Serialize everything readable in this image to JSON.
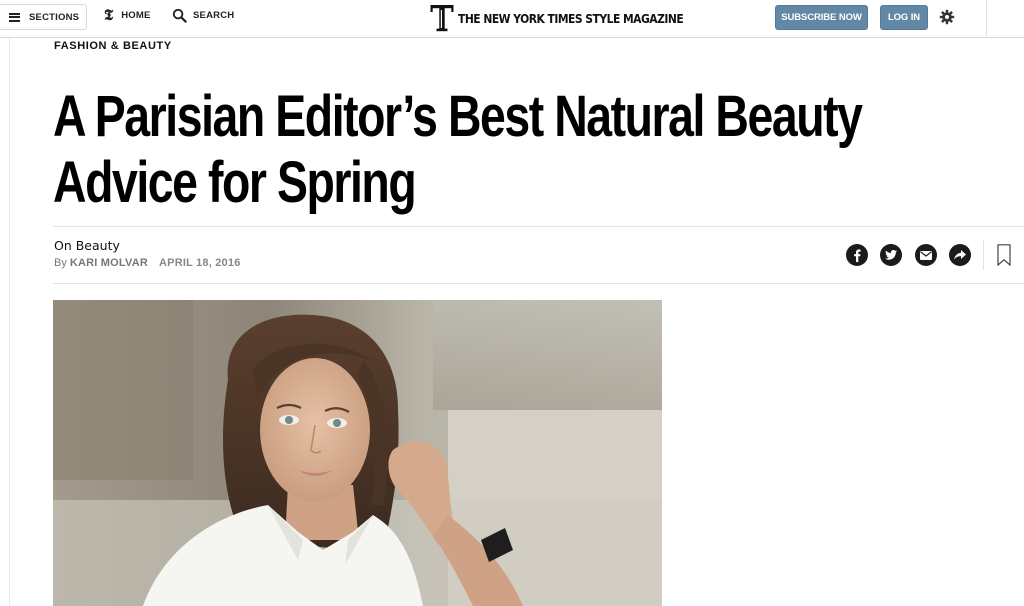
{
  "nav": {
    "sections_label": "SECTIONS",
    "home_label": "HOME",
    "search_label": "SEARCH"
  },
  "masthead": {
    "title": "THE NEW YORK TIMES STYLE MAGAZINE"
  },
  "actions": {
    "subscribe_label": "SUBSCRIBE NOW",
    "login_label": "LOG IN"
  },
  "article": {
    "kicker": "FASHION & BEAUTY",
    "headline": "A Parisian Editor’s Best Natural Beauty Advice for Spring",
    "column": "On Beauty",
    "byline_prefix": "By",
    "author": "KARI MOLVAR",
    "date": "APRIL 18, 2016"
  },
  "share_icons": [
    "facebook-icon",
    "twitter-icon",
    "email-icon",
    "share-icon",
    "bookmark-icon"
  ],
  "colors": {
    "button_bg": "#6288a5",
    "text": "#121212",
    "meta_text": "#777777",
    "rule": "#e2e2e2"
  }
}
